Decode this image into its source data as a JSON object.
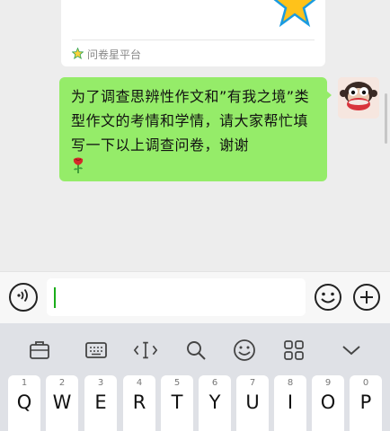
{
  "shared_card": {
    "footer_icon": "star-icon",
    "footer_text": "问卷星平台"
  },
  "message": {
    "text": "为了调查思辨性作文和”有我之境”类型作文的考情和学情，请大家帮忙填写一下以上调查问卷，谢谢",
    "emoji": "rose-emoji",
    "bubble_color": "#95ec69"
  },
  "input_bar": {
    "value": "",
    "placeholder": "",
    "voice_icon": "voice-icon",
    "emoji_icon": "emoji-icon",
    "plus_icon": "plus-icon",
    "caret_color": "#1aad19"
  },
  "keyboard": {
    "toolbar": [
      "clipboard-icon",
      "keyboard-icon",
      "cursor-icon",
      "search-icon",
      "emoji-icon",
      "grid-icon",
      "collapse-icon"
    ],
    "keys": [
      {
        "num": "1",
        "letter": "Q"
      },
      {
        "num": "2",
        "letter": "W"
      },
      {
        "num": "3",
        "letter": "E"
      },
      {
        "num": "4",
        "letter": "R"
      },
      {
        "num": "5",
        "letter": "T"
      },
      {
        "num": "6",
        "letter": "Y"
      },
      {
        "num": "7",
        "letter": "U"
      },
      {
        "num": "8",
        "letter": "I"
      },
      {
        "num": "9",
        "letter": "O"
      },
      {
        "num": "0",
        "letter": "P"
      }
    ]
  }
}
